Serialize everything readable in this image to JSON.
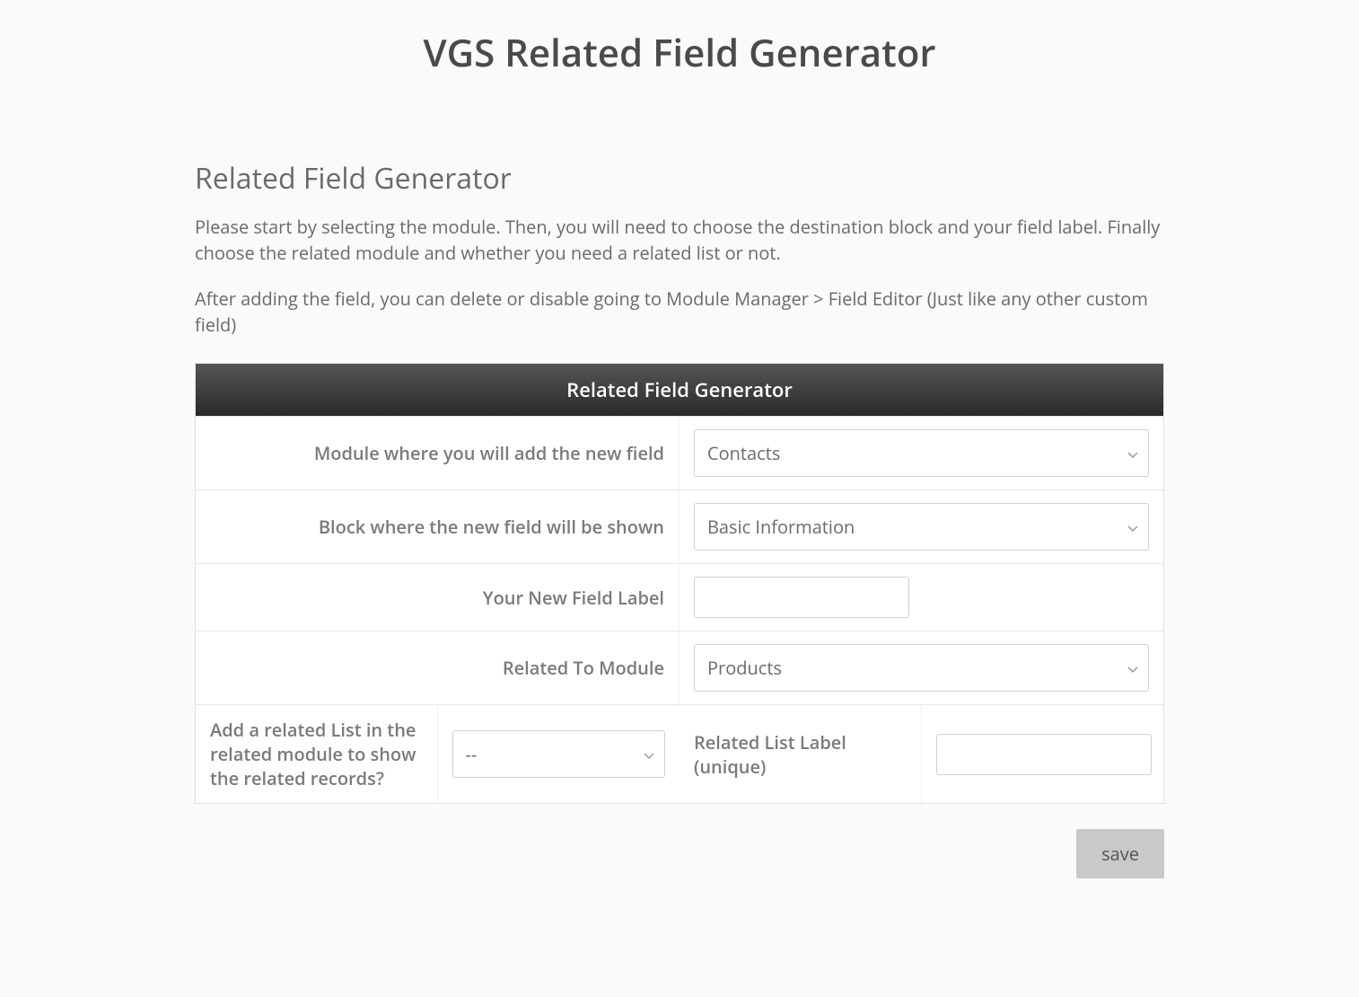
{
  "page_title": "VGS Related Field Generator",
  "section_heading": "Related Field Generator",
  "intro_paragraph_1": "Please start by selecting the module. Then, you will need to choose the destination block and your field label. Finally choose the related module and whether you need a related list or not.",
  "intro_paragraph_2": "After adding the field, you can delete or disable going to Module Manager > Field Editor (Just like any other custom field)",
  "table_header": "Related Field Generator",
  "rows": {
    "module": {
      "label": "Module where you will add the new field",
      "value": "Contacts"
    },
    "block": {
      "label": "Block where the new field will be shown",
      "value": "Basic Information"
    },
    "field_label": {
      "label": "Your New Field Label",
      "value": ""
    },
    "related_to": {
      "label": "Related To Module",
      "value": "Products"
    },
    "add_related_list": {
      "label": "Add a related List in the related module to show the related records?",
      "value": "--"
    },
    "related_list_label": {
      "label": "Related List Label (unique)",
      "value": ""
    }
  },
  "save_button": "save"
}
